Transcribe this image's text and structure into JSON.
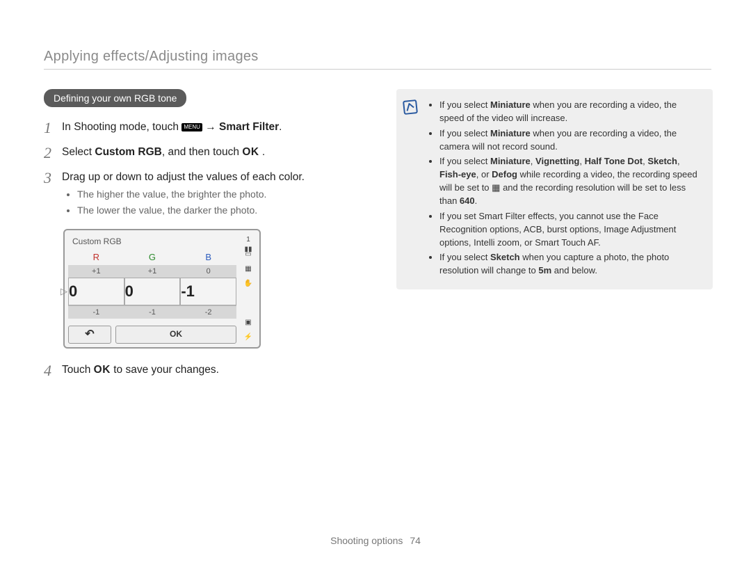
{
  "page": {
    "section_title": "Applying effects/Adjusting images",
    "footer_label": "Shooting options",
    "page_number": "74"
  },
  "pill": {
    "heading": "Defining your own RGB tone"
  },
  "steps": {
    "s1": {
      "num": "1",
      "prefix": "In Shooting mode, touch ",
      "menu": "MENU",
      "arrow": " → ",
      "bold": "Smart Filter",
      "suffix": "."
    },
    "s2": {
      "num": "2",
      "prefix": "Select ",
      "bold": "Custom RGB",
      "mid": ", and then touch ",
      "ok": "OK",
      "suffix": " ."
    },
    "s3": {
      "num": "3",
      "text": "Drag up or down to adjust the values of each color.",
      "b1": "The higher the value, the brighter the photo.",
      "b2": "The lower the value, the darker the photo."
    },
    "s4": {
      "num": "4",
      "prefix": "Touch ",
      "ok": "OK",
      "suffix": "  to save your changes."
    }
  },
  "camera_ui": {
    "title": "Custom RGB",
    "headers": {
      "r": "R",
      "g": "G",
      "b": "B"
    },
    "row_plus": {
      "r": "+1",
      "g": "+1",
      "b": "0"
    },
    "row_main": {
      "r": "0",
      "g": "0",
      "b": "-1"
    },
    "row_minus": {
      "r": "-1",
      "g": "-1",
      "b": "-2"
    },
    "btn_back": "↶",
    "btn_ok": "OK",
    "side_count": "1"
  },
  "notes": {
    "n1": {
      "pre": "If you select ",
      "b1": "Miniature",
      "post": " when you are recording a video, the speed of the video will increase."
    },
    "n2": {
      "pre": "If you select ",
      "b1": "Miniature",
      "post": " when you are recording a video, the camera will not record sound."
    },
    "n3": {
      "pre": "If you select ",
      "b1": "Miniature",
      "c1": ", ",
      "b2": "Vignetting",
      "c2": ", ",
      "b3": "Half Tone Dot",
      "c3": ", ",
      "b4": "Sketch",
      "c4": ", ",
      "b5": "Fish-eye",
      "c5": ", or ",
      "b6": "Defog",
      "mid": " while recording a video, the recording speed will be set to ",
      "mid2": " and the recording resolution will be set to less than ",
      "b7": "640",
      "end": "."
    },
    "n4": "If you set Smart Filter effects, you cannot use the Face Recognition options, ACB, burst options, Image Adjustment options, Intelli zoom, or Smart Touch AF.",
    "n5": {
      "pre": "If you select ",
      "b1": "Sketch",
      "post1": " when you capture a photo, the photo resolution will change to ",
      "res": "5m",
      "post2": " and below."
    }
  }
}
